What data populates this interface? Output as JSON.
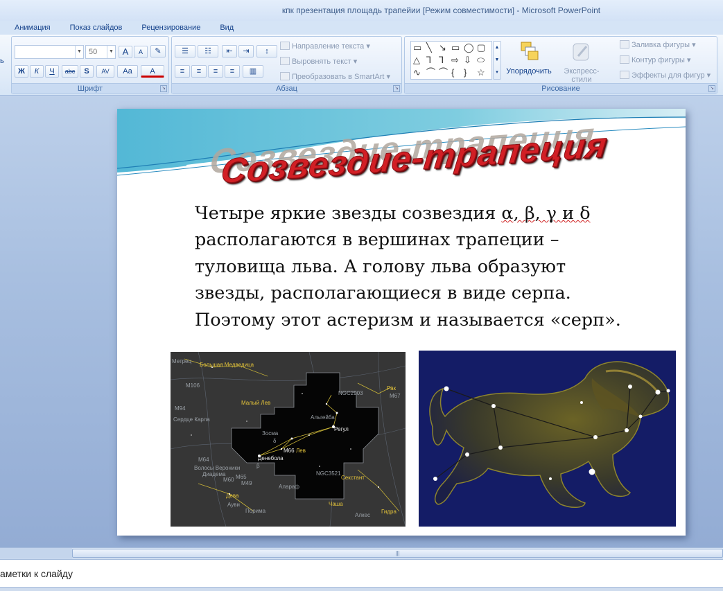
{
  "window": {
    "title": "кпк презентация площадь трапейии [Режим совместимости] - Microsoft PowerPoint"
  },
  "tabs": [
    "Анимация",
    "Показ слайдов",
    "Рецензирование",
    "Вид"
  ],
  "ribbon": {
    "font_group": {
      "label": "Шрифт",
      "font_name": "",
      "font_size": "50",
      "grow": "A",
      "shrink": "A",
      "bold": "Ж",
      "italic": "К",
      "underline": "Ч",
      "strike": "abc",
      "shadow": "S",
      "spacing": "AV",
      "case": "Aa",
      "color": "A",
      "left_stub": "ь"
    },
    "paragraph_group": {
      "label": "Абзац",
      "text_direction": "Направление текста",
      "align_text": "Выровнять текст",
      "smartart": "Преобразовать в SmartArt"
    },
    "drawing_group": {
      "label": "Рисование",
      "arrange": "Упорядочить",
      "quick_styles": "Экспресс-стили",
      "shape_fill": "Заливка фигуры",
      "shape_outline": "Контур фигуры",
      "shape_effects": "Эффекты для фигур"
    }
  },
  "slide": {
    "title": "Созвездие-трапеция",
    "body_lines": [
      "Четыре яркие звезды созвездия",
      "располагаются в вершинах трапеции –",
      "туловища льва. А голову льва образуют",
      "звезды, располагающиеся в виде серпа.",
      "Поэтому этот астеризм и называется «серп»."
    ],
    "greek": "α, β, γ и δ",
    "starmap_labels": {
      "l1": "Метрец",
      "l2": "Большая Медведица",
      "l3": "M106",
      "l4": "M94",
      "l5": "Сердце Карла",
      "l6": "Малый Лев",
      "l7": "NGC2903",
      "l8": "Рак",
      "l9": "M67",
      "l10": "Альгейба",
      "l11": "Зосма",
      "l12": "Регул",
      "l13": "Лев",
      "l14": "M66",
      "l15": "Денебола",
      "l16": "M64",
      "l17": "Волосы Вероники",
      "l18": "Диадема",
      "l19": "M60",
      "l20": "M49",
      "l21": "NGC3521",
      "l22": "Секстант",
      "l23": "Дева",
      "l24": "Алараф",
      "l25": "Чаша",
      "l26": "Ауви",
      "l27": "Порима",
      "l28": "Алкес",
      "l29": "Гидра",
      "l30": "δ",
      "l31": "β",
      "l32": "M65"
    }
  },
  "notes": {
    "placeholder": "аметки к слайду"
  }
}
